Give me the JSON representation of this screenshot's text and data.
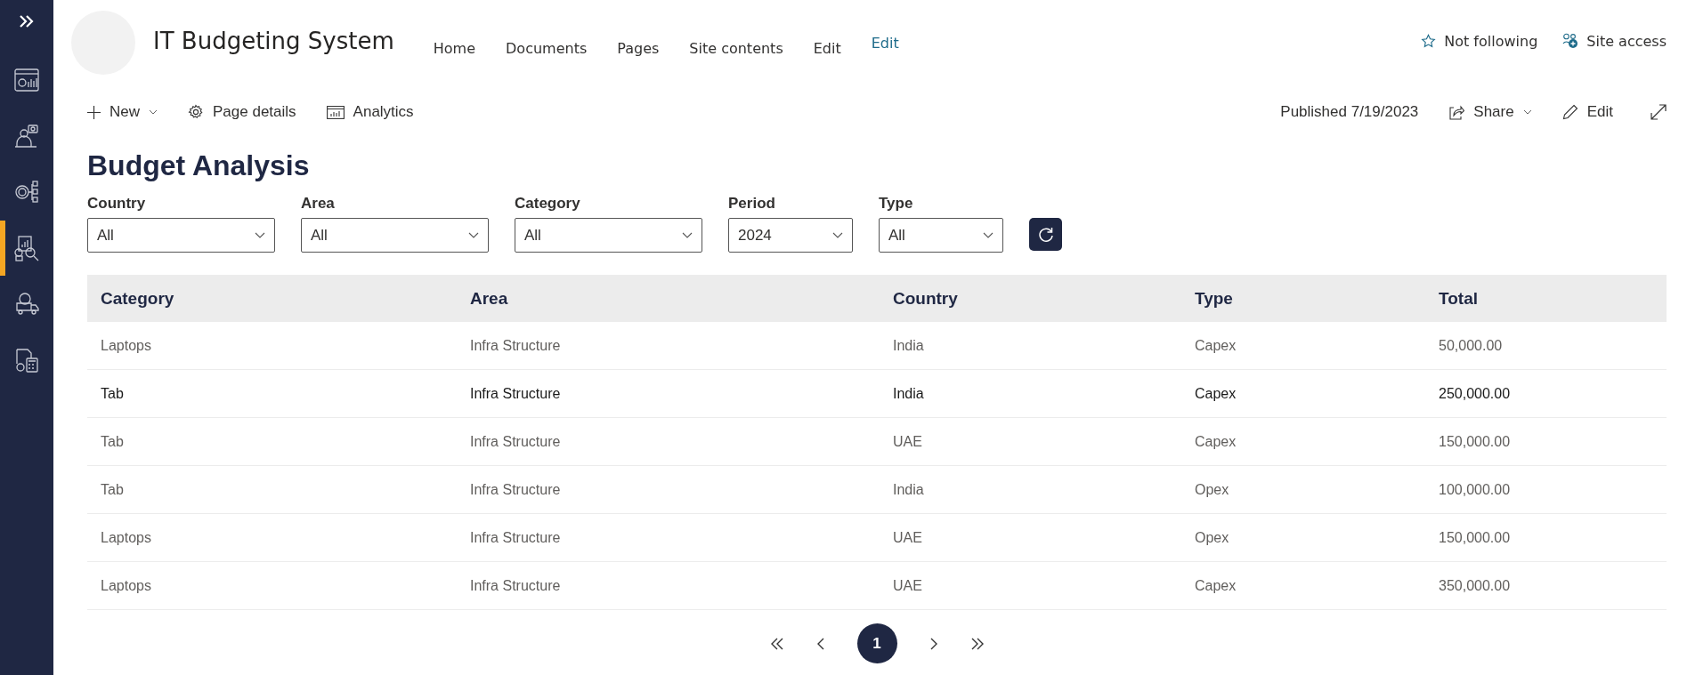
{
  "sidebar": {
    "items": [
      {
        "kind": "dashboard",
        "selected": false
      },
      {
        "kind": "person",
        "selected": false
      },
      {
        "kind": "hierarchy",
        "selected": false
      },
      {
        "kind": "report",
        "selected": true
      },
      {
        "kind": "truck",
        "selected": false
      },
      {
        "kind": "calculator",
        "selected": false
      }
    ]
  },
  "site": {
    "title": "IT Budgeting System",
    "nav": [
      {
        "label": "Home",
        "selected": false
      },
      {
        "label": "Documents",
        "selected": false
      },
      {
        "label": "Pages",
        "selected": false
      },
      {
        "label": "Site contents",
        "selected": false
      },
      {
        "label": "Edit",
        "selected": false
      },
      {
        "label": "Edit",
        "selected": true
      }
    ],
    "follow": "Not following",
    "access": "Site access"
  },
  "command_bar": {
    "new": "New",
    "page_details": "Page details",
    "analytics": "Analytics",
    "published": "Published 7/19/2023",
    "share": "Share",
    "edit": "Edit"
  },
  "page_title": "Budget Analysis",
  "filters": [
    {
      "label": "Country",
      "value": "All"
    },
    {
      "label": "Area",
      "value": "All"
    },
    {
      "label": "Category",
      "value": "All"
    },
    {
      "label": "Period",
      "value": "2024"
    },
    {
      "label": "Type",
      "value": "All"
    }
  ],
  "table": {
    "columns": [
      "Category",
      "Area",
      "Country",
      "Type",
      "Total"
    ],
    "rows": [
      {
        "cells": [
          "Laptops",
          "Infra Structure",
          "India",
          "Capex",
          "50,000.00"
        ],
        "selected": false
      },
      {
        "cells": [
          "Tab",
          "Infra Structure",
          "India",
          "Capex",
          "250,000.00"
        ],
        "selected": true
      },
      {
        "cells": [
          "Tab",
          "Infra Structure",
          "UAE",
          "Capex",
          "150,000.00"
        ],
        "selected": false
      },
      {
        "cells": [
          "Tab",
          "Infra Structure",
          "India",
          "Opex",
          "100,000.00"
        ],
        "selected": false
      },
      {
        "cells": [
          "Laptops",
          "Infra Structure",
          "UAE",
          "Opex",
          "150,000.00"
        ],
        "selected": false
      },
      {
        "cells": [
          "Laptops",
          "Infra Structure",
          "UAE",
          "Capex",
          "350,000.00"
        ],
        "selected": false
      }
    ]
  },
  "pagination": {
    "current": "1"
  }
}
